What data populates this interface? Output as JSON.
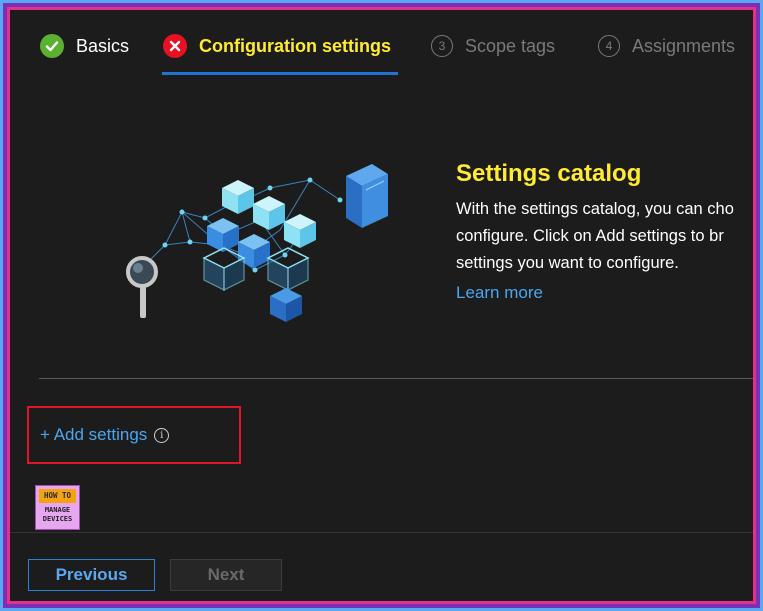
{
  "tabs": [
    {
      "label": "Basics",
      "state": "complete",
      "icon": "check-icon"
    },
    {
      "label": "Configuration settings",
      "state": "error",
      "icon": "error-x-icon"
    },
    {
      "label": "Scope tags",
      "step": "3",
      "state": "inactive"
    },
    {
      "label": "Assignments",
      "step": "4",
      "state": "inactive"
    }
  ],
  "catalog": {
    "title": "Settings catalog",
    "desc_lines": [
      "With the settings catalog, you can cho",
      "configure. Click on Add settings to br",
      "settings you want to configure."
    ],
    "learn_more": "Learn more"
  },
  "add_settings": {
    "label": "+ Add settings",
    "info_glyph": "i"
  },
  "logo": {
    "line1": "HOW TO",
    "line2": "MANAGE",
    "line3": "DEVICES"
  },
  "footer": {
    "previous_label": "Previous",
    "next_label": "Next"
  },
  "colors": {
    "accent_yellow": "#ffeb33",
    "link_blue": "#4aa6f0",
    "error_red": "#e81123",
    "success_green": "#5bb130",
    "highlight_box": "#e0142a"
  }
}
